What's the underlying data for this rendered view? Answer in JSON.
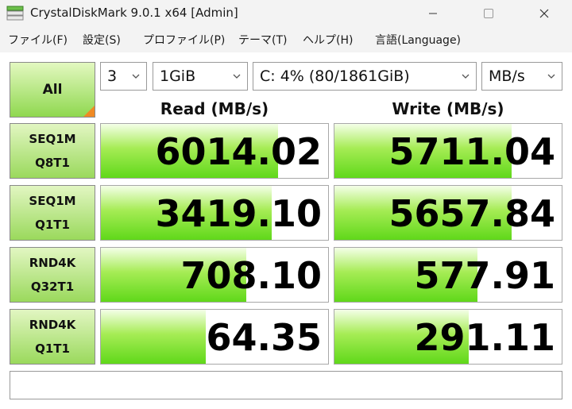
{
  "window": {
    "title": "CrystalDiskMark 9.0.1 x64 [Admin]",
    "icon": "crystaldiskmark-app-icon",
    "controls": [
      "minimize-icon",
      "maximize-icon",
      "close-icon"
    ]
  },
  "menu": {
    "file": "ファイル(F)",
    "settings": "設定(S)",
    "profile": "プロファイル(P)",
    "theme": "テーマ(T)",
    "help": "ヘルプ(H)",
    "language": "言語(Language)"
  },
  "toolbar": {
    "all_label": "All",
    "count": "3",
    "size": "1GiB",
    "drive": "C: 4% (80/1861GiB)",
    "unit": "MB/s"
  },
  "headers": {
    "read": "Read (MB/s)",
    "write": "Write (MB/s)"
  },
  "tests": [
    {
      "line1": "SEQ1M",
      "line2": "Q8T1",
      "read": "6014.02",
      "write": "5711.04",
      "read_level": 0.78,
      "write_level": 0.78
    },
    {
      "line1": "SEQ1M",
      "line2": "Q1T1",
      "read": "3419.10",
      "write": "5657.84",
      "read_level": 0.75,
      "write_level": 0.78
    },
    {
      "line1": "RND4K",
      "line2": "Q32T1",
      "read": "708.10",
      "write": "577.91",
      "read_level": 0.64,
      "write_level": 0.63
    },
    {
      "line1": "RND4K",
      "line2": "Q1T1",
      "read": "64.35",
      "write": "291.11",
      "read_level": 0.46,
      "write_level": 0.59
    }
  ],
  "colors": {
    "bar_green": "#60d81a",
    "accent_orange": "#f08a24"
  },
  "status": ""
}
